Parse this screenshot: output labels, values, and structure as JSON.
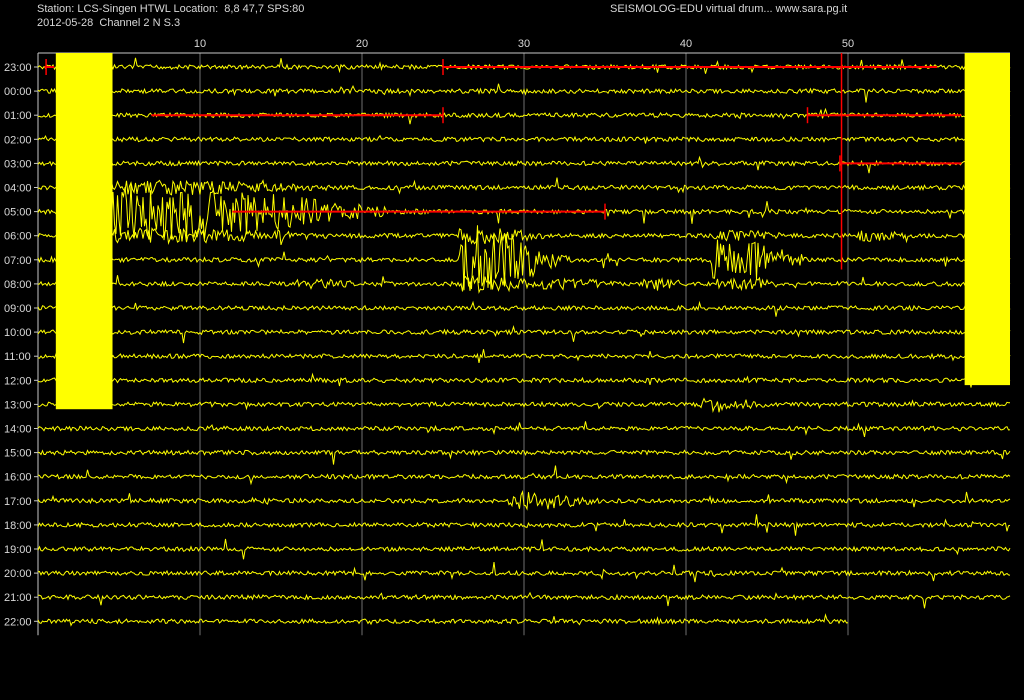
{
  "header": {
    "station_line": "Station: LCS-Singen HTWL Location:  8,8 47,7 SPS:80",
    "date_line": "2012-05-28  Channel 2 N S.3",
    "credit": "SEISMOLOG-EDU virtual drum... www.sara.pg.it"
  },
  "colors": {
    "background": "#000000",
    "trace": "#ffff00",
    "highlight": "#ff0000",
    "grid": "#c8c8c8",
    "text": "#d8d8d8"
  },
  "chart_data": {
    "type": "line",
    "title": "",
    "xlabel": "",
    "ylabel": "",
    "x_unit_note": "minutes past the hour",
    "x_ticks": [
      10,
      20,
      30,
      40,
      50
    ],
    "xlim": [
      0,
      60
    ],
    "rows": [
      "23:00",
      "00:00",
      "01:00",
      "02:00",
      "03:00",
      "04:00",
      "05:00",
      "06:00",
      "07:00",
      "08:00",
      "09:00",
      "10:00",
      "11:00",
      "12:00",
      "13:00",
      "14:00",
      "15:00",
      "16:00",
      "17:00",
      "18:00",
      "19:00",
      "20:00",
      "21:00",
      "22:00"
    ],
    "last_row_end_minute": 50,
    "saturated_blocks": [
      {
        "from_row": 0,
        "to_row": 14.2,
        "x_start": 1.1,
        "x_end": 4.6
      },
      {
        "from_row": 0,
        "to_row": 13.2,
        "x_start": 57.2,
        "x_end": 60
      }
    ],
    "events": [
      {
        "row": 6,
        "minute": 8,
        "amplitude": 60,
        "duration": 14
      },
      {
        "row": 8,
        "minute": 27.5,
        "amplitude": 70,
        "duration": 5
      },
      {
        "row": 8,
        "minute": 43,
        "amplitude": 45,
        "duration": 5
      },
      {
        "row": 9,
        "minute": 38,
        "amplitude": 14,
        "duration": 3
      },
      {
        "row": 9,
        "minute": 32.5,
        "amplitude": 12,
        "duration": 5
      },
      {
        "row": 9,
        "minute": 17,
        "amplitude": 10,
        "duration": 5
      },
      {
        "row": 7,
        "minute": 51.5,
        "amplitude": 12,
        "duration": 3
      },
      {
        "row": 14,
        "minute": 42,
        "amplitude": 16,
        "duration": 4
      },
      {
        "row": 15,
        "minute": 14,
        "amplitude": 6,
        "duration": 4
      },
      {
        "row": 18,
        "minute": 30.5,
        "amplitude": 20,
        "duration": 5
      }
    ],
    "red_segments": [
      {
        "row": 0,
        "x_start": 0.4,
        "x_end": 1,
        "spike": 0.5
      },
      {
        "row": 0,
        "x_start": 25,
        "x_end": 55.5,
        "spike": 25
      },
      {
        "row": 2,
        "x_start": 7,
        "x_end": 25,
        "spike": 25
      },
      {
        "row": 2,
        "x_start": 47.5,
        "x_end": 57,
        "spike": 47.5
      },
      {
        "row": 4,
        "x_start": 49.5,
        "x_end": 57,
        "spike": 49.5
      },
      {
        "row": 6,
        "x_start": 12,
        "x_end": 35,
        "spike": 35
      }
    ]
  }
}
